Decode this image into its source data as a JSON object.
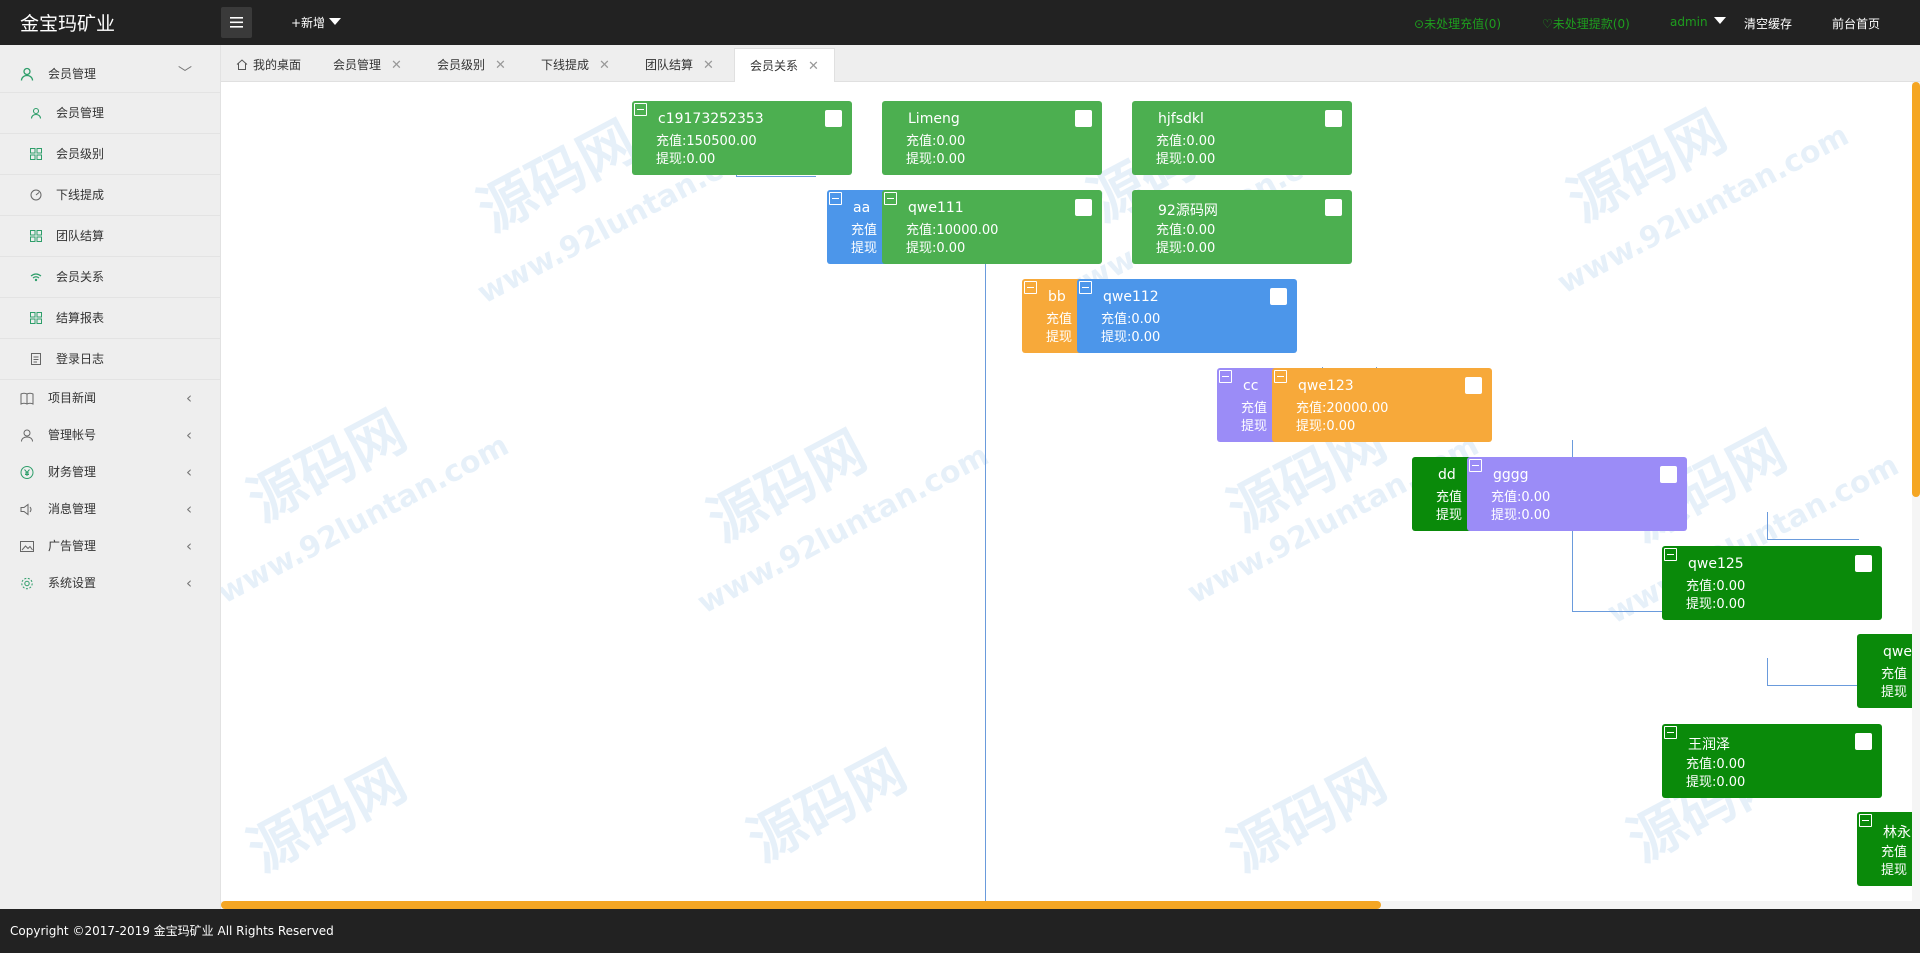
{
  "header": {
    "logo": "金宝玛矿业",
    "add_new": "+新增",
    "pending_recharge": "未处理充值(0)",
    "pending_withdraw": "未处理提款(0)",
    "admin": "admin",
    "clear_cache": "清空缓存",
    "frontend_home": "前台首页"
  },
  "sidebar": {
    "member_group": "会员管理",
    "items": [
      {
        "label": "会员管理"
      },
      {
        "label": "会员级别"
      },
      {
        "label": "下线提成"
      },
      {
        "label": "团队结算"
      },
      {
        "label": "会员关系"
      },
      {
        "label": "结算报表"
      },
      {
        "label": "登录日志"
      }
    ],
    "groups": [
      {
        "label": "项目新闻"
      },
      {
        "label": "管理帐号"
      },
      {
        "label": "财务管理"
      },
      {
        "label": "消息管理"
      },
      {
        "label": "广告管理"
      },
      {
        "label": "系统设置"
      }
    ]
  },
  "tabs": [
    {
      "label": "我的桌面"
    },
    {
      "label": "会员管理"
    },
    {
      "label": "会员级别"
    },
    {
      "label": "下线提成"
    },
    {
      "label": "团队结算"
    },
    {
      "label": "会员关系"
    }
  ],
  "tree": {
    "nodes": [
      {
        "name": "c19173252353",
        "recharge": "充值:150500.00",
        "withdraw": "提现:0.00"
      },
      {
        "name": "Limeng",
        "recharge": "充值:0.00",
        "withdraw": "提现:0.00"
      },
      {
        "name": "hjfsdkl",
        "recharge": "充值:0.00",
        "withdraw": "提现:0.00"
      },
      {
        "name": "aa",
        "recharge": "充值",
        "withdraw": "提现"
      },
      {
        "name": "qwe111",
        "recharge": "充值:10000.00",
        "withdraw": "提现:0.00"
      },
      {
        "name": "92源码网",
        "recharge": "充值:0.00",
        "withdraw": "提现:0.00"
      },
      {
        "name": "bb",
        "recharge": "充值",
        "withdraw": "提现"
      },
      {
        "name": "qwe112",
        "recharge": "充值:0.00",
        "withdraw": "提现:0.00"
      },
      {
        "name": "cc",
        "recharge": "充值",
        "withdraw": "提现"
      },
      {
        "name": "qwe123",
        "recharge": "充值:20000.00",
        "withdraw": "提现:0.00"
      },
      {
        "name": "dd",
        "recharge": "充值",
        "withdraw": "提现"
      },
      {
        "name": "gggg",
        "recharge": "充值:0.00",
        "withdraw": "提现:0.00"
      },
      {
        "name": "qwe125",
        "recharge": "充值:0.00",
        "withdraw": "提现:0.00"
      },
      {
        "name": "qwe",
        "recharge": "充值",
        "withdraw": "提现"
      },
      {
        "name": "王润泽",
        "recharge": "充值:0.00",
        "withdraw": "提现:0.00"
      },
      {
        "name": "林永",
        "recharge": "充值",
        "withdraw": "提现"
      }
    ]
  },
  "watermark": {
    "brand": "源码网",
    "url": "www.92luntan.com"
  },
  "footer": {
    "copyright": "Copyright ©2017-2019 金宝玛矿业 All Rights Reserved"
  },
  "colors": {
    "green": "#4caf50",
    "dark_green": "#0a8a0a",
    "blue": "#4c96ea",
    "orange": "#f7a93a",
    "purple": "#9b8cf7",
    "scroll": "#f5a623"
  }
}
